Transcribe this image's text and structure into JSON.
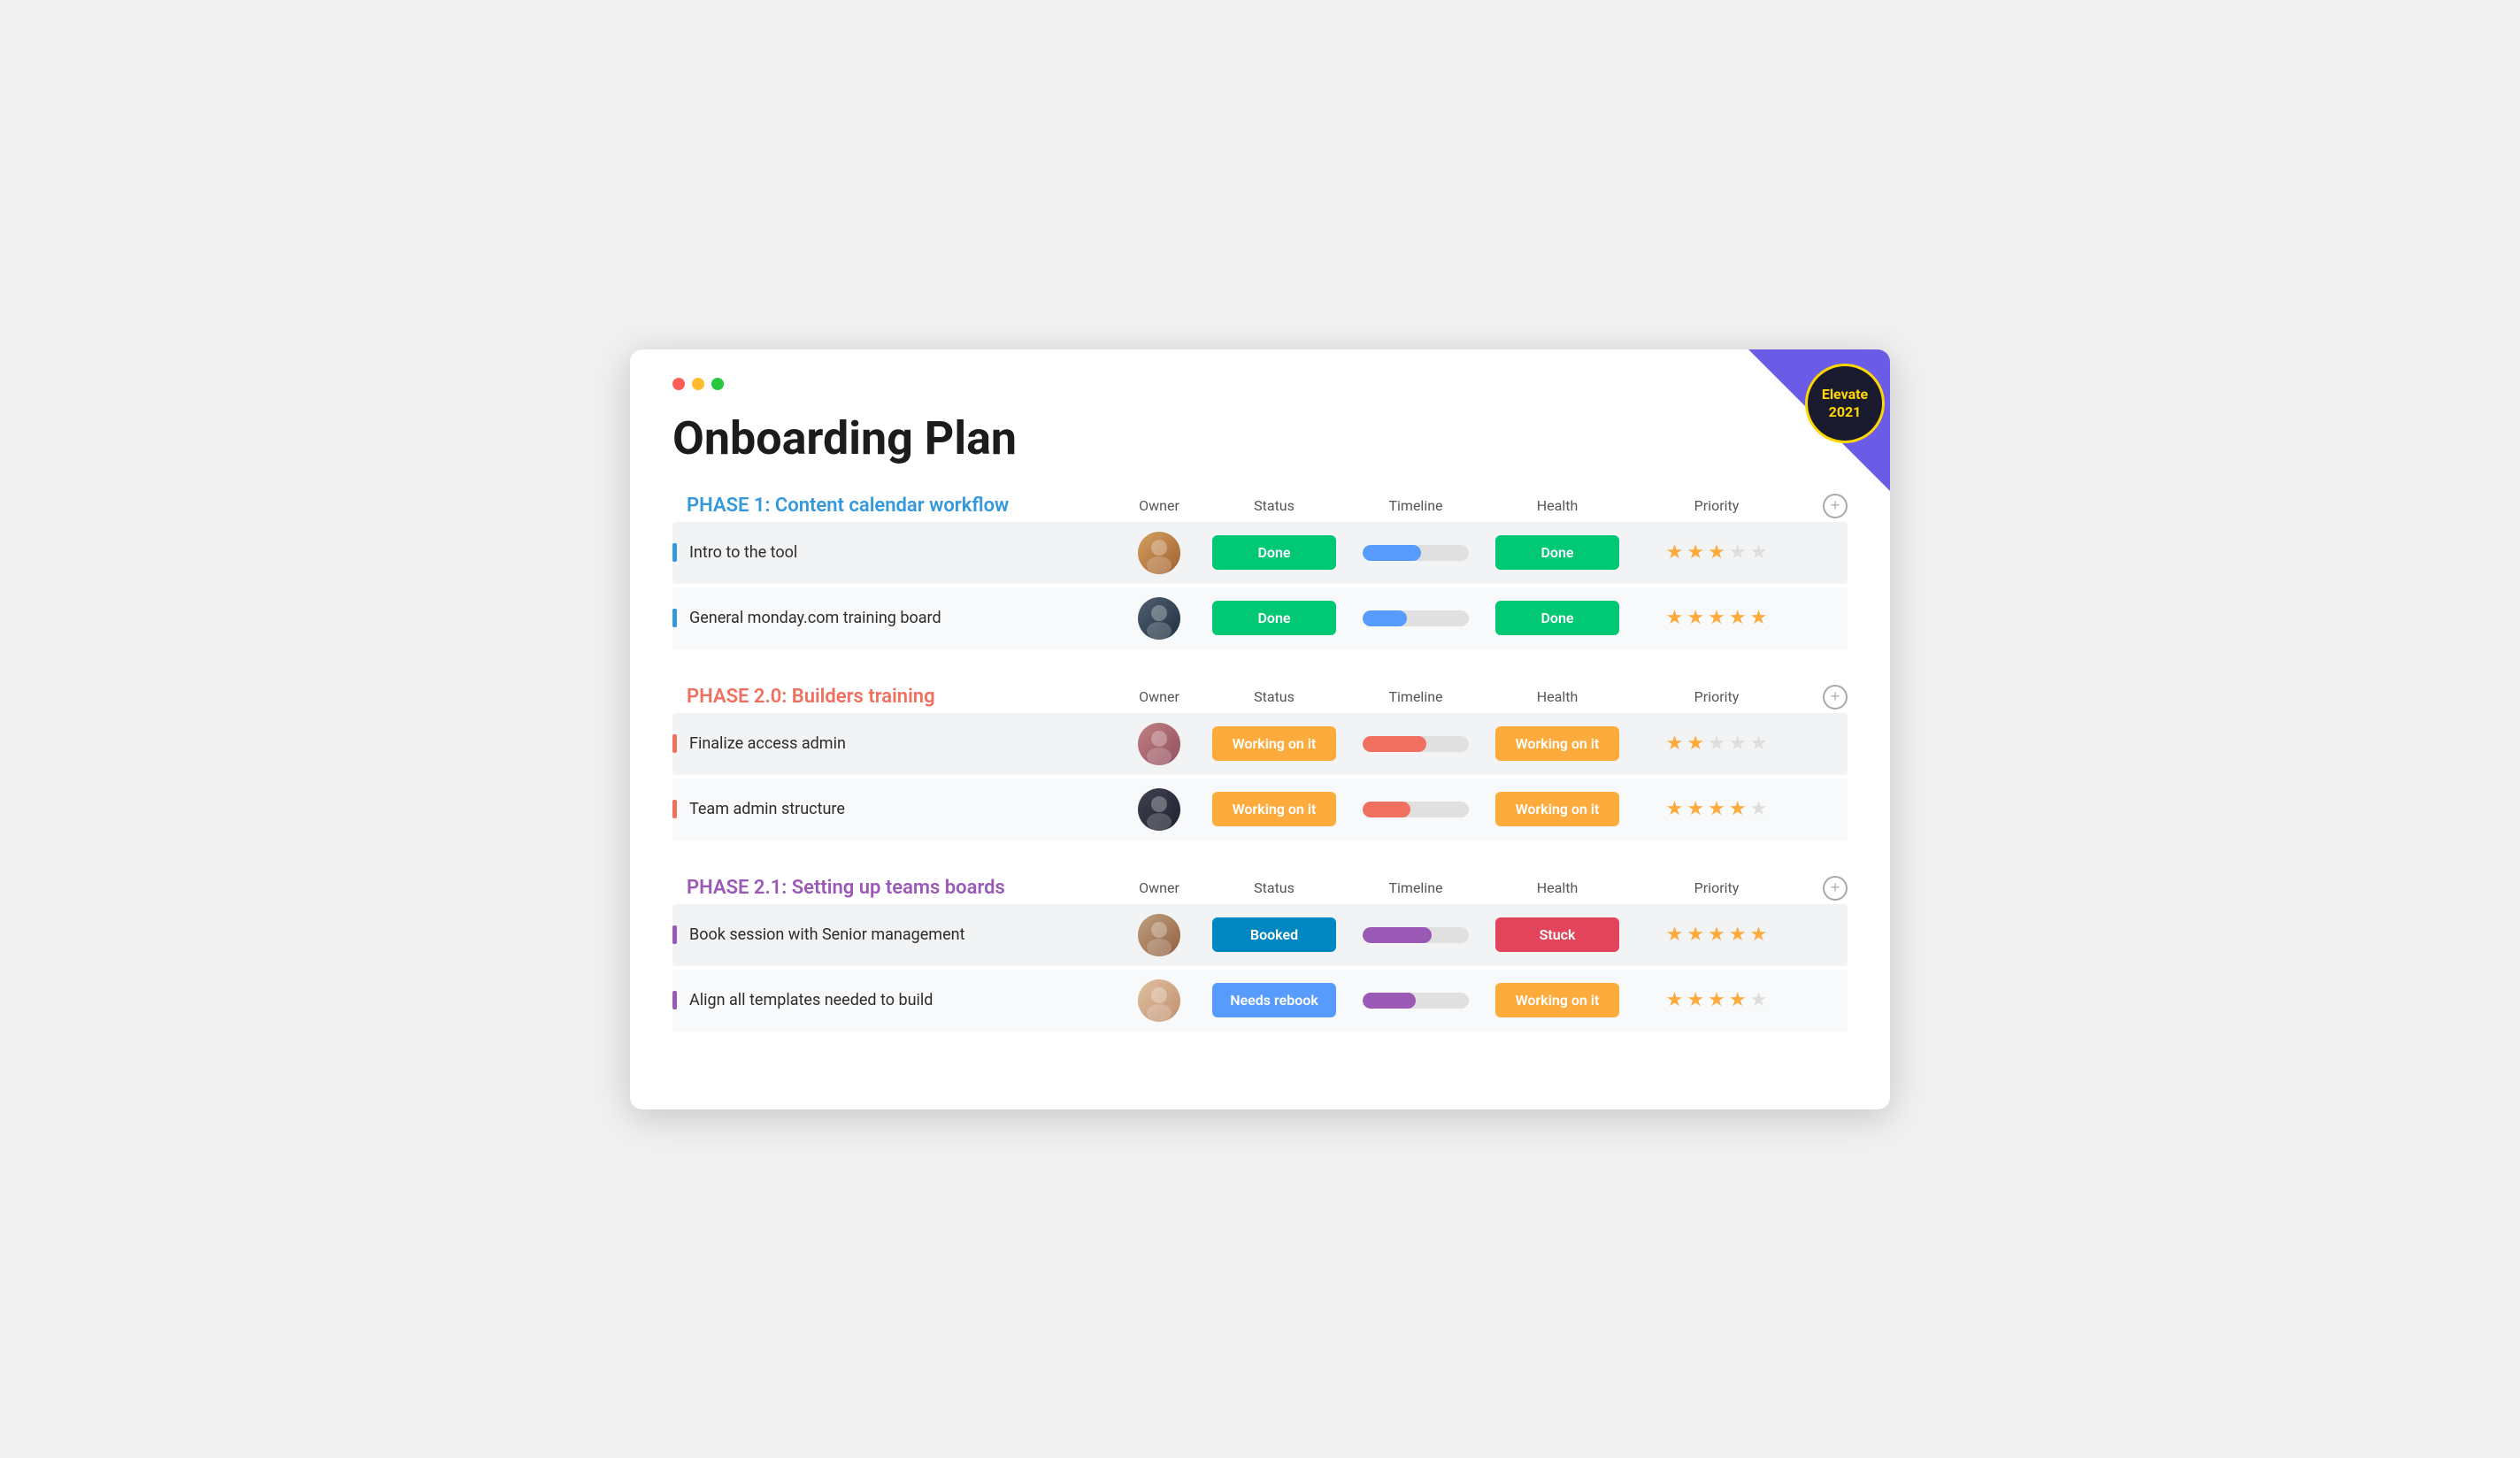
{
  "window": {
    "title": "Onboarding Plan"
  },
  "page": {
    "title": "Onboarding Plan"
  },
  "elevate": {
    "line1": "Elevate",
    "line2": "2021"
  },
  "phases": [
    {
      "id": "phase1",
      "title": "PHASE 1: Content calendar workflow",
      "title_color": "blue",
      "bar_color": "blue",
      "columns": [
        "Owner",
        "Status",
        "Timeline",
        "Health",
        "Priority"
      ],
      "tasks": [
        {
          "name": "Intro to the tool",
          "avatar_class": "av1",
          "avatar_emoji": "👤",
          "status_label": "Done",
          "status_class": "status-done",
          "timeline_fill_class": "fill-blue",
          "health_label": "Done",
          "health_class": "health-done",
          "stars": [
            1,
            1,
            1,
            0,
            0
          ]
        },
        {
          "name": "General monday.com training board",
          "avatar_class": "av2",
          "avatar_emoji": "👤",
          "status_label": "Done",
          "status_class": "status-done",
          "timeline_fill_class": "fill-blue2",
          "health_label": "Done",
          "health_class": "health-done",
          "stars": [
            1,
            1,
            1,
            1,
            1
          ]
        }
      ]
    },
    {
      "id": "phase2",
      "title": "PHASE 2.0: Builders training",
      "title_color": "coral",
      "bar_color": "coral",
      "columns": [
        "Owner",
        "Status",
        "Timeline",
        "Health",
        "Priority"
      ],
      "tasks": [
        {
          "name": "Finalize access admin",
          "avatar_class": "av3",
          "avatar_emoji": "👤",
          "status_label": "Working on it",
          "status_class": "status-working",
          "timeline_fill_class": "fill-orange",
          "health_label": "Working on it",
          "health_class": "health-working",
          "stars": [
            1,
            1,
            0,
            0,
            0
          ]
        },
        {
          "name": "Team admin structure",
          "avatar_class": "av4",
          "avatar_emoji": "👤",
          "status_label": "Working on it",
          "status_class": "status-working",
          "timeline_fill_class": "fill-orange2",
          "health_label": "Working on it",
          "health_class": "health-working",
          "stars": [
            1,
            1,
            1,
            1,
            0
          ]
        }
      ]
    },
    {
      "id": "phase21",
      "title": "PHASE 2.1: Setting up teams boards",
      "title_color": "purple",
      "bar_color": "purple",
      "columns": [
        "Owner",
        "Status",
        "Timeline",
        "Health",
        "Priority"
      ],
      "tasks": [
        {
          "name": "Book session with Senior management",
          "avatar_class": "av5",
          "avatar_emoji": "👤",
          "status_label": "Booked",
          "status_class": "status-booked",
          "timeline_fill_class": "fill-purple",
          "health_label": "Stuck",
          "health_class": "health-stuck",
          "stars": [
            1,
            1,
            1,
            1,
            1
          ]
        },
        {
          "name": "Align all templates needed to build",
          "avatar_class": "av6",
          "avatar_emoji": "👤",
          "status_label": "Needs rebook",
          "status_class": "status-needs-rebook",
          "timeline_fill_class": "fill-purple2",
          "health_label": "Working on it",
          "health_class": "health-working",
          "stars": [
            1,
            1,
            1,
            1,
            0
          ]
        }
      ]
    }
  ]
}
